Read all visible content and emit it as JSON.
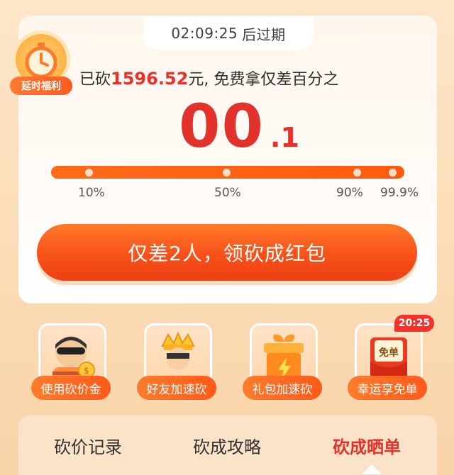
{
  "timer": {
    "time": "02:09:25",
    "suffix": "后过期"
  },
  "badge": {
    "label": "延时福利",
    "icon": "stopwatch-icon"
  },
  "headline": {
    "prefix": "已砍",
    "amount": "1596.52",
    "suffix": "元, 免费拿仅差百分之"
  },
  "percent": {
    "main": "00",
    "decimal": ".1"
  },
  "progress": {
    "ticks": [
      "10%",
      "50%",
      "90%",
      "99.9%"
    ],
    "current_percent": 99.9,
    "colors": {
      "track": "#ff5a10",
      "dot": "#ffe0c4"
    }
  },
  "cta": {
    "label": "仅差2人，领砍成红包"
  },
  "actions": [
    {
      "label": "使用砍价金",
      "icon": "thief-coin-icon"
    },
    {
      "label": "好友加速砍",
      "icon": "crown-friend-icon"
    },
    {
      "label": "礼包加速砍",
      "icon": "gift-box-lightning-icon"
    },
    {
      "label": "幸运享免单",
      "icon": "free-order-envelope-icon"
    }
  ],
  "free_order": {
    "tag": "免单",
    "countdown": "20:25"
  },
  "tabs": [
    {
      "label": "砍价记录",
      "active": false
    },
    {
      "label": "砍成攻略",
      "active": false
    },
    {
      "label": "砍成晒单",
      "active": true
    }
  ],
  "colors": {
    "accent": "#e3312b",
    "orange": "#ff5a1a",
    "background": "#fde6c8"
  }
}
